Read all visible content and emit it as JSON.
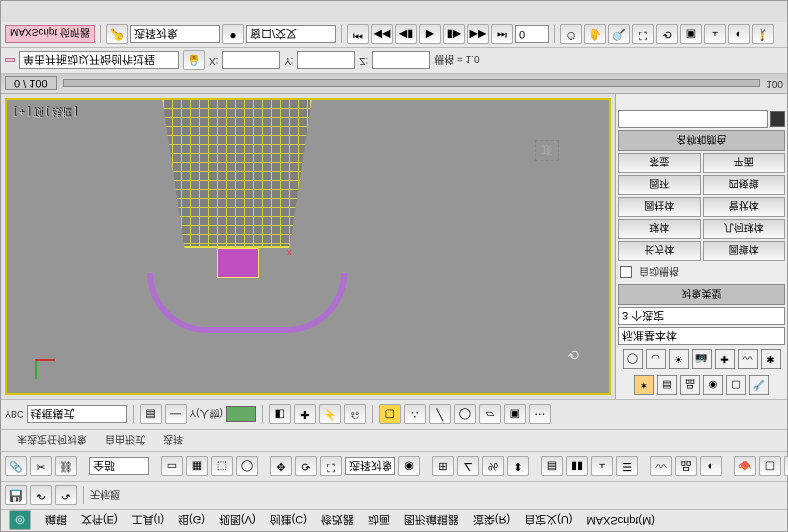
{
  "menubar": {
    "items": [
      "编辑",
      "文件(E)",
      "工具(I)",
      "组(G)",
      "视图(V)",
      "创建(C)",
      "修改器",
      "动画",
      "图形编辑器",
      "渲染(R)",
      "自定义(U)",
      "MAXScript(M)"
    ]
  },
  "quickbar": {
    "file_label": "无标题"
  },
  "iconrow": {
    "spinner": "全部"
  },
  "toolbar3": {
    "label_obj": "选择对象",
    "sel_filter": "窗口/交叉"
  },
  "toolbar2": {
    "y_label": "Y(人物)",
    "status": "线框模式"
  },
  "side": {
    "name_input": "",
    "rollout1": "标准基本体",
    "btns": {
      "a": "长方体",
      "b": "圆锥体",
      "c": "球体",
      "d": "几何球体",
      "e": "圆柱体",
      "f": "管状体",
      "g": "圆环",
      "h": "四棱锥",
      "i": "茶壶",
      "j": "平面"
    },
    "autogrid": "自动栅格",
    "rollout2": "名称和颜色",
    "rollout3": "对象类型",
    "filter": "3 个选定"
  },
  "timeline": {
    "frame": "0 / 100",
    "range_start": "0",
    "range_end": "100"
  },
  "coord": {
    "ybc": "YBC",
    "x": "X:",
    "y": "Y:",
    "z": "Z:",
    "grid": "栅格 = 1.0"
  },
  "status": {
    "prompt": "单击并拖动以开始创作过程",
    "title": "MAXScript 侦听器"
  },
  "vp": {
    "label": "[ + ] 顶 [ 线框 ]"
  },
  "bottom": {
    "mode": "未选定任何对象",
    "addtime": "添加时间标记"
  }
}
